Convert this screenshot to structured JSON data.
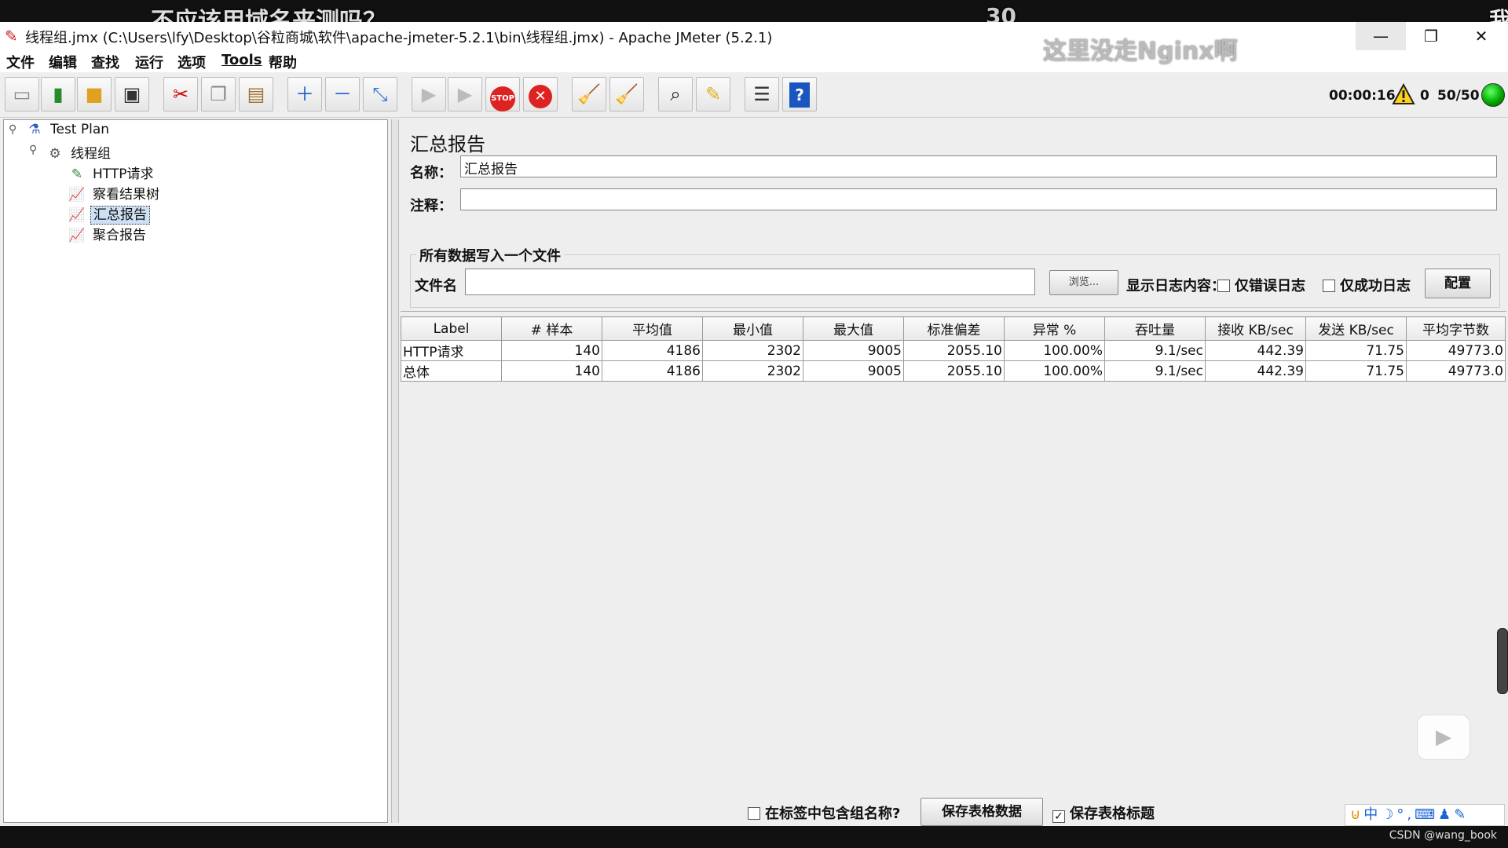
{
  "overlays": {
    "text1": "不应该用域名来测吗？",
    "text2": "30",
    "text3": "这里没走Nginx啊",
    "text4": "我"
  },
  "window": {
    "title": "线程组.jmx (C:\\Users\\lfy\\Desktop\\谷粒商城\\软件\\apache-jmeter-5.2.1\\bin\\线程组.jmx) - Apache JMeter (5.2.1)",
    "min": "—",
    "max": "❐",
    "close": "✕"
  },
  "menu": {
    "file": "文件",
    "edit": "编辑",
    "search": "查找",
    "run": "运行",
    "options": "选项",
    "tools": "Tools",
    "help": "帮助"
  },
  "toolbar": {
    "elapsed": "00:00:16",
    "warnings": "0",
    "threads": "50/50",
    "stop_label": "STOP"
  },
  "tree": {
    "test_plan": "Test Plan",
    "thread_group": "线程组",
    "http_request": "HTTP请求",
    "view_results_tree": "察看结果树",
    "summary_report": "汇总报告",
    "aggregate_report": "聚合报告"
  },
  "panel": {
    "title": "汇总报告",
    "name_label": "名称：",
    "name_value": "汇总报告",
    "comment_label": "注释：",
    "comment_value": "",
    "file_section": "所有数据写入一个文件",
    "filename_label": "文件名",
    "filename_value": "",
    "browse": "浏览...",
    "log_display_label": "显示日志内容：",
    "errors_only": "仅错误日志",
    "success_only": "仅成功日志",
    "configure": "配置"
  },
  "table": {
    "headers": [
      "Label",
      "# 样本",
      "平均值",
      "最小值",
      "最大值",
      "标准偏差",
      "异常 %",
      "吞吐量",
      "接收 KB/sec",
      "发送 KB/sec",
      "平均字节数"
    ],
    "rows": [
      [
        "HTTP请求",
        "140",
        "4186",
        "2302",
        "9005",
        "2055.10",
        "100.00%",
        "9.1/sec",
        "442.39",
        "71.75",
        "49773.0"
      ],
      [
        "总体",
        "140",
        "4186",
        "2302",
        "9005",
        "2055.10",
        "100.00%",
        "9.1/sec",
        "442.39",
        "71.75",
        "49773.0"
      ]
    ]
  },
  "bottom": {
    "include_group_name": "在标签中包含组名称?",
    "save_table_data": "保存表格数据",
    "save_table_header": "保存表格标题",
    "check": "✓"
  },
  "tray": {
    "text": "中"
  },
  "watermark": "CSDN @wang_book"
}
